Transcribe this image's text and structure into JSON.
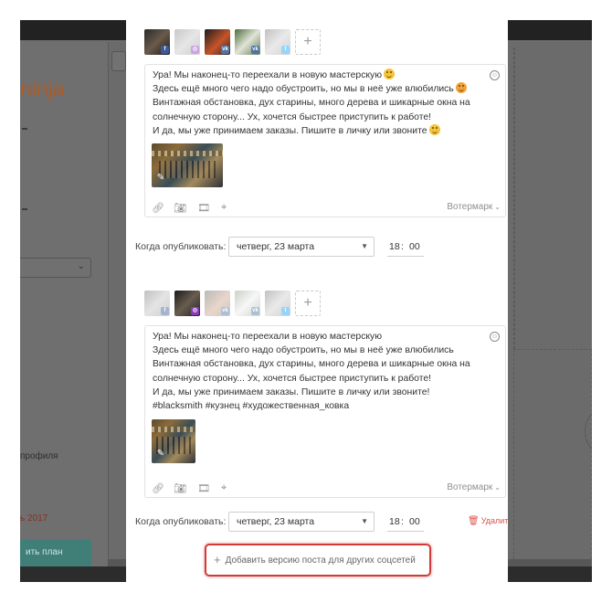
{
  "background": {
    "brand": "ninja",
    "sidebar_text_profile": "профиля",
    "sidebar_date": "ь 2017",
    "sidebar_plan_button": "ить план"
  },
  "posts": [
    {
      "accounts": [
        {
          "network": "facebook-icon",
          "active": true
        },
        {
          "network": "instagram-icon",
          "active": false
        },
        {
          "network": "vk-icon",
          "active": true
        },
        {
          "network": "vk-icon",
          "active": true
        },
        {
          "network": "twitter-icon",
          "active": false
        }
      ],
      "lines": [
        "Ура! Мы наконец-то переехали в новую мастерскую",
        "Здесь ещё много чего надо обустроить, но мы в неё уже влюбились",
        "Винтажная обстановка, дух старины, много дерева и шикарные окна на",
        "солнечную сторону... Ух, хочется быстрее приступить к работе!",
        "И да, мы уже принимаем заказы. Пишите в личку или звоните"
      ],
      "watermark": "Вотермарк",
      "publish_label": "Когда опубликовать:",
      "date": "четверг, 23 марта",
      "hour": "18",
      "minute": "00"
    },
    {
      "accounts": [
        {
          "network": "facebook-icon",
          "active": false
        },
        {
          "network": "instagram-icon",
          "active": true
        },
        {
          "network": "vk-icon",
          "active": false
        },
        {
          "network": "vk-icon",
          "active": false
        },
        {
          "network": "twitter-icon",
          "active": false
        }
      ],
      "lines": [
        "Ура! Мы наконец-то переехали в новую мастерскую",
        "Здесь ещё много чего надо обустроить, но мы в неё уже влюбились",
        "Винтажная обстановка, дух старины, много дерева и шикарные окна на",
        "солнечную сторону... Ух, хочется быстрее приступить к работе!",
        "И да, мы уже принимаем заказы. Пишите в личку или звоните!",
        "#blacksmith #кузнец #художественная_ковка"
      ],
      "watermark": "Вотермарк",
      "publish_label": "Когда опубликовать:",
      "date": "четверг, 23 марта",
      "hour": "18",
      "minute": "00",
      "delete_label": "Удалить"
    }
  ],
  "add_version_label": "Добавить версию поста для других соцсетей",
  "colors": {
    "accent_red": "#d33a3a",
    "delete_red": "#d9534f",
    "plan_button": "#3f7f78",
    "brand_orange": "#b05a25"
  }
}
